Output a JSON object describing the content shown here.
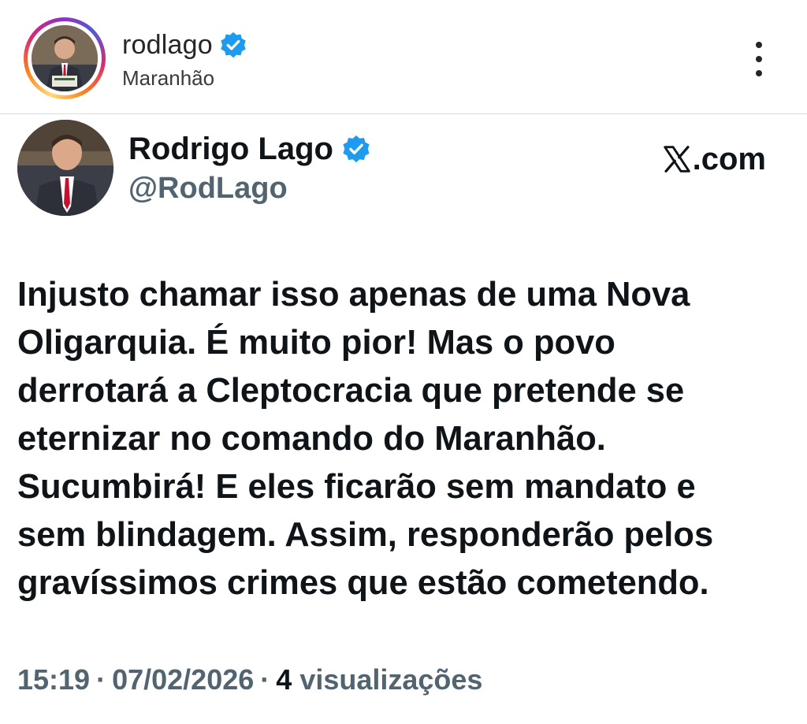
{
  "post_header": {
    "username": "rodlago",
    "location": "Maranhão",
    "verified": true,
    "more_icon": "more-vertical-icon",
    "avatar_ring_colors": [
      "#feda75",
      "#fa7e1e",
      "#d62976",
      "#962fbf",
      "#4f5bd5"
    ]
  },
  "tweet": {
    "author_name": "Rodrigo Lago",
    "handle": "@RodLago",
    "verified": true,
    "source": ".com",
    "source_icon": "x-logo-icon",
    "text_lines": [
      "Injusto chamar isso apenas de uma Nova",
      "Oligarquia. É muito pior! Mas o povo",
      "derrotará a Cleptocracia que pretende se",
      "eternizar no comando do Maranhão.",
      "Sucumbirá! E eles ficarão sem mandato e",
      "sem blindagem. Assim, responderão pelos",
      "gravíssimos crimes que estão cometendo."
    ],
    "time": "15:19",
    "date": "07/02/2026",
    "views_count": "4",
    "views_label": "visualizações",
    "separator": "·"
  },
  "colors": {
    "verified_blue": "#1d9bf0",
    "text_primary": "#0f1419",
    "text_secondary": "#536471",
    "divider": "#dbdbdb"
  }
}
